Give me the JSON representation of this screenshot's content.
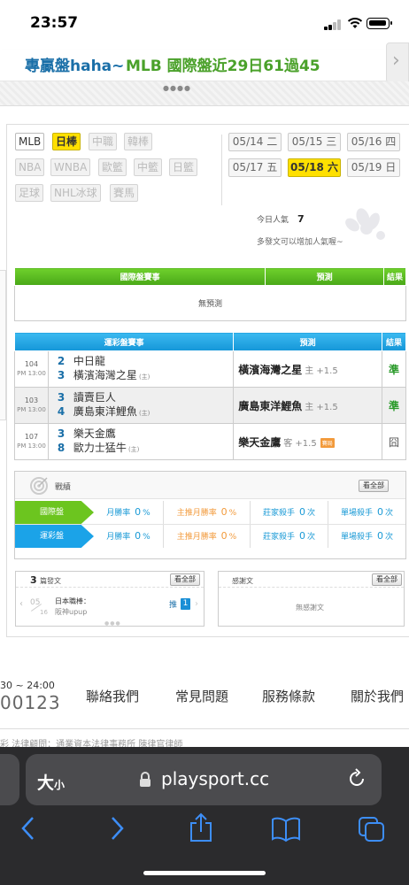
{
  "status_bar": {
    "time": "23:57"
  },
  "banner": {
    "part1": "專贏盤haha~",
    "part2": "MLB 國際盤近29日61過45"
  },
  "sports": [
    {
      "label": "MLB",
      "state": "on"
    },
    {
      "label": "日棒",
      "state": "selected"
    },
    {
      "label": "中職",
      "state": "off"
    },
    {
      "label": "韓棒",
      "state": "off"
    },
    {
      "label": "NBA",
      "state": "off"
    },
    {
      "label": "WNBA",
      "state": "off"
    },
    {
      "label": "歐籃",
      "state": "off"
    },
    {
      "label": "中籃",
      "state": "off"
    },
    {
      "label": "日籃",
      "state": "off"
    },
    {
      "label": "足球",
      "state": "off"
    },
    {
      "label": "NHL冰球",
      "state": "off"
    },
    {
      "label": "賽馬",
      "state": "off"
    }
  ],
  "dates": [
    {
      "label": "05/14 二",
      "selected": false
    },
    {
      "label": "05/15 三",
      "selected": false
    },
    {
      "label": "05/16 四",
      "selected": false
    },
    {
      "label": "05/17 五",
      "selected": false
    },
    {
      "label": "05/18 六",
      "selected": true
    },
    {
      "label": "05/19 日",
      "selected": false
    }
  ],
  "popularity": {
    "label": "今日人氣",
    "value": "7",
    "hint": "多發文可以增加人氣喔~"
  },
  "intl_table": {
    "headers": [
      "國際盤賽事",
      "預測",
      "結果"
    ],
    "empty": "無預測"
  },
  "lottery_table": {
    "headers": [
      "運彩盤賽事",
      "預測",
      "結果"
    ],
    "rows": [
      {
        "id": "104",
        "time": "PM 13:00",
        "away_no": "2",
        "away": "中日龍",
        "home_no": "3",
        "home": "橫濱海灣之星",
        "home_mark": "(主)",
        "pick": "橫濱海灣之星",
        "pick_side": "主",
        "line": "+1.5",
        "badge": "",
        "result": "準",
        "result_type": "win"
      },
      {
        "id": "103",
        "time": "PM 13:00",
        "away_no": "3",
        "away": "讀賣巨人",
        "home_no": "4",
        "home": "廣島東洋鯉魚",
        "home_mark": "(主)",
        "pick": "廣島東洋鯉魚",
        "pick_side": "主",
        "line": "+1.5",
        "badge": "",
        "result": "準",
        "result_type": "win"
      },
      {
        "id": "107",
        "time": "PM 13:00",
        "away_no": "3",
        "away": "樂天金鷹",
        "home_no": "8",
        "home": "歐力士猛牛",
        "home_mark": "(主)",
        "pick": "樂天金鷹",
        "pick_side": "客",
        "line": "+1.5",
        "badge": "賽局",
        "result": "囧",
        "result_type": "tie"
      }
    ]
  },
  "record": {
    "title": "戰績",
    "view_all": "看全部",
    "rows": [
      {
        "label": "國際盤",
        "color": "#6cc51f",
        "cells": [
          {
            "pre": "月勝率",
            "val": "0",
            "post": "%",
            "color": "#1a9ad6"
          },
          {
            "pre": "主推月勝率",
            "val": "0",
            "post": "%",
            "color": "#f29a3b"
          },
          {
            "pre": "莊家殺手",
            "val": "0",
            "post": "次",
            "color": "#1a9ad6"
          },
          {
            "pre": "單場殺手",
            "val": "0",
            "post": "次",
            "color": "#1a9ad6"
          }
        ]
      },
      {
        "label": "運彩盤",
        "color": "#1ba3e8",
        "cells": [
          {
            "pre": "月勝率",
            "val": "0",
            "post": "%",
            "color": "#1a9ad6"
          },
          {
            "pre": "主推月勝率",
            "val": "0",
            "post": "%",
            "color": "#f29a3b"
          },
          {
            "pre": "莊家殺手",
            "val": "0",
            "post": "次",
            "color": "#1a9ad6"
          },
          {
            "pre": "單場殺手",
            "val": "0",
            "post": "次",
            "color": "#1a9ad6"
          }
        ]
      }
    ]
  },
  "posts": {
    "count": "3",
    "label": "篇發文",
    "view_all": "看全部",
    "date_month": "05",
    "date_day": "16",
    "item_title": "日本職棒：",
    "item_sub": "阪神upup",
    "push_label": "推",
    "push_count": "1"
  },
  "thanks": {
    "title": "感謝文",
    "view_all": "看全部",
    "empty": "無感謝文"
  },
  "footer": {
    "hours": "30 ~ 24:00",
    "phone": "00123",
    "links": [
      "聯絡我們",
      "常見問題",
      "服務條款",
      "關於我們"
    ],
    "legal": "彩  法律顧問：通業資本法律事務所  陳律官律師"
  },
  "browser": {
    "aa_big": "大",
    "aa_small": "小",
    "url": "playsport.cc"
  }
}
